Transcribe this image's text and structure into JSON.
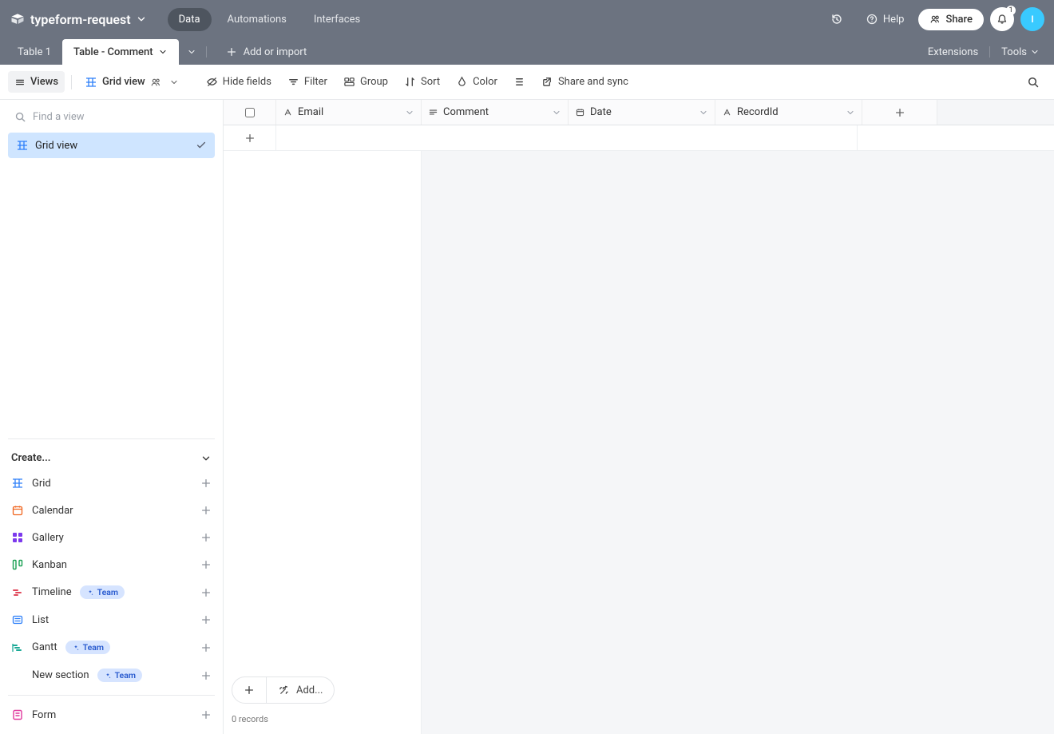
{
  "header": {
    "base_name": "typeform-request",
    "nav": {
      "data": "Data",
      "automations": "Automations",
      "interfaces": "Interfaces"
    },
    "help": "Help",
    "share": "Share",
    "notification_count": "1",
    "avatar_letter": "I"
  },
  "tabs": {
    "table1": "Table 1",
    "table2": "Table - Comment",
    "add_or_import": "Add or import",
    "extensions": "Extensions",
    "tools": "Tools"
  },
  "toolbar": {
    "views": "Views",
    "grid_view": "Grid view",
    "hide_fields": "Hide fields",
    "filter": "Filter",
    "group": "Group",
    "sort": "Sort",
    "color": "Color",
    "share_sync": "Share and sync"
  },
  "sidebar": {
    "search_placeholder": "Find a view",
    "active_view": "Grid view",
    "create_label": "Create...",
    "items": [
      {
        "label": "Grid",
        "icon": "grid",
        "iconClass": "ic-blue",
        "team": false
      },
      {
        "label": "Calendar",
        "icon": "calendar",
        "iconClass": "ic-orange",
        "team": false
      },
      {
        "label": "Gallery",
        "icon": "gallery",
        "iconClass": "ic-purple",
        "team": false
      },
      {
        "label": "Kanban",
        "icon": "kanban",
        "iconClass": "ic-green",
        "team": false
      },
      {
        "label": "Timeline",
        "icon": "timeline",
        "iconClass": "ic-red",
        "team": true
      },
      {
        "label": "List",
        "icon": "list",
        "iconClass": "ic-blue",
        "team": false
      },
      {
        "label": "Gantt",
        "icon": "gantt",
        "iconClass": "ic-teal",
        "team": true
      },
      {
        "label": "New section",
        "icon": "none",
        "iconClass": "",
        "team": true
      }
    ],
    "team_label": "Team",
    "form_label": "Form"
  },
  "columns": {
    "email": "Email",
    "comment": "Comment",
    "date": "Date",
    "recordid": "RecordId"
  },
  "footer": {
    "add_label": "Add...",
    "record_count": "0 records"
  }
}
